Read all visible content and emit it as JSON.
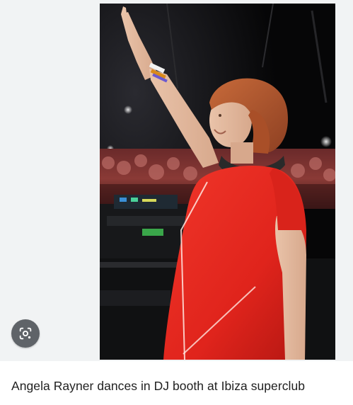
{
  "media": {
    "lens_icon": "google-lens-icon"
  },
  "caption": {
    "text": "Angela Rayner dances in DJ booth at Ibiza superclub"
  },
  "colors": {
    "background": "#ffffff",
    "media_background": "#f1f3f4",
    "lens_button": "#5f6368",
    "caption_text": "#1f1f1f",
    "dress": "#e0241c",
    "hair": "#b85a30"
  }
}
